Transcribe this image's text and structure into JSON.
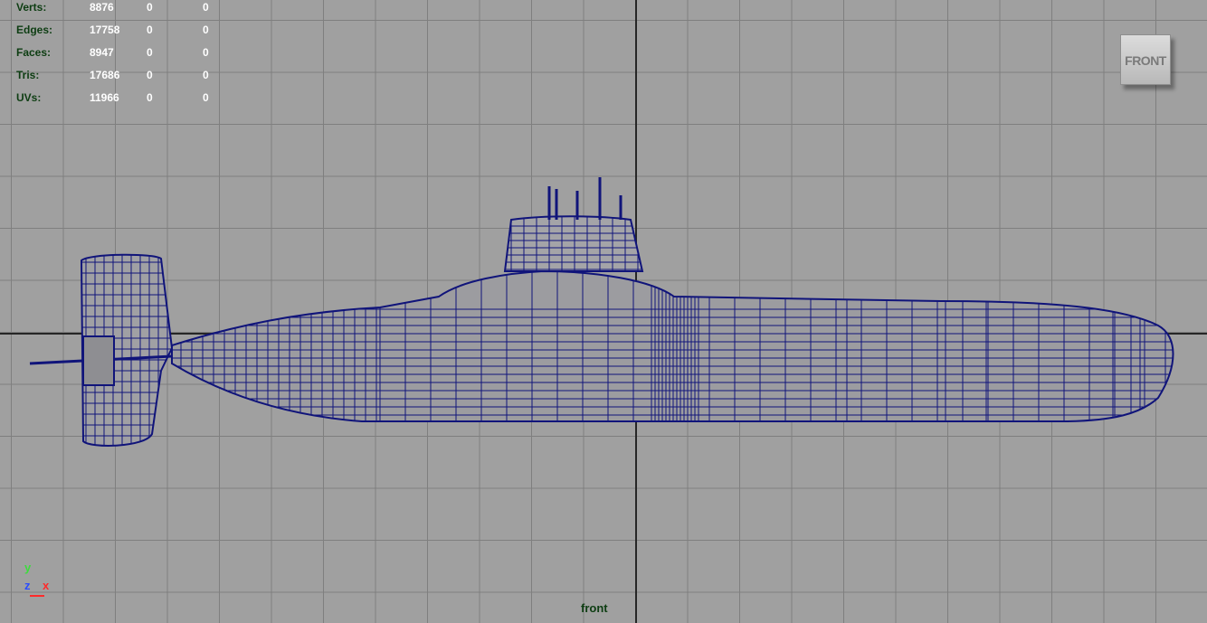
{
  "stats": [
    {
      "label": "Verts:",
      "values": [
        "8876",
        "0",
        "0"
      ]
    },
    {
      "label": "Edges:",
      "values": [
        "17758",
        "0",
        "0"
      ]
    },
    {
      "label": "Faces:",
      "values": [
        "8947",
        "0",
        "0"
      ]
    },
    {
      "label": "Tris:",
      "values": [
        "17686",
        "0",
        "0"
      ]
    },
    {
      "label": "UVs:",
      "values": [
        "11966",
        "0",
        "0"
      ]
    }
  ],
  "view_cube": {
    "label": "FRONT"
  },
  "axis_gizmo": {
    "y": "y",
    "z": "z",
    "x": "x"
  },
  "camera_label": "front",
  "colors": {
    "background": "#a0a0a0",
    "grid": "#7f7f7f",
    "wire": "#10147a",
    "hud_label": "#0d3d12",
    "axis_y": "#3ddc3d",
    "axis_z": "#2a4dff",
    "axis_x": "#ff2a2a"
  }
}
